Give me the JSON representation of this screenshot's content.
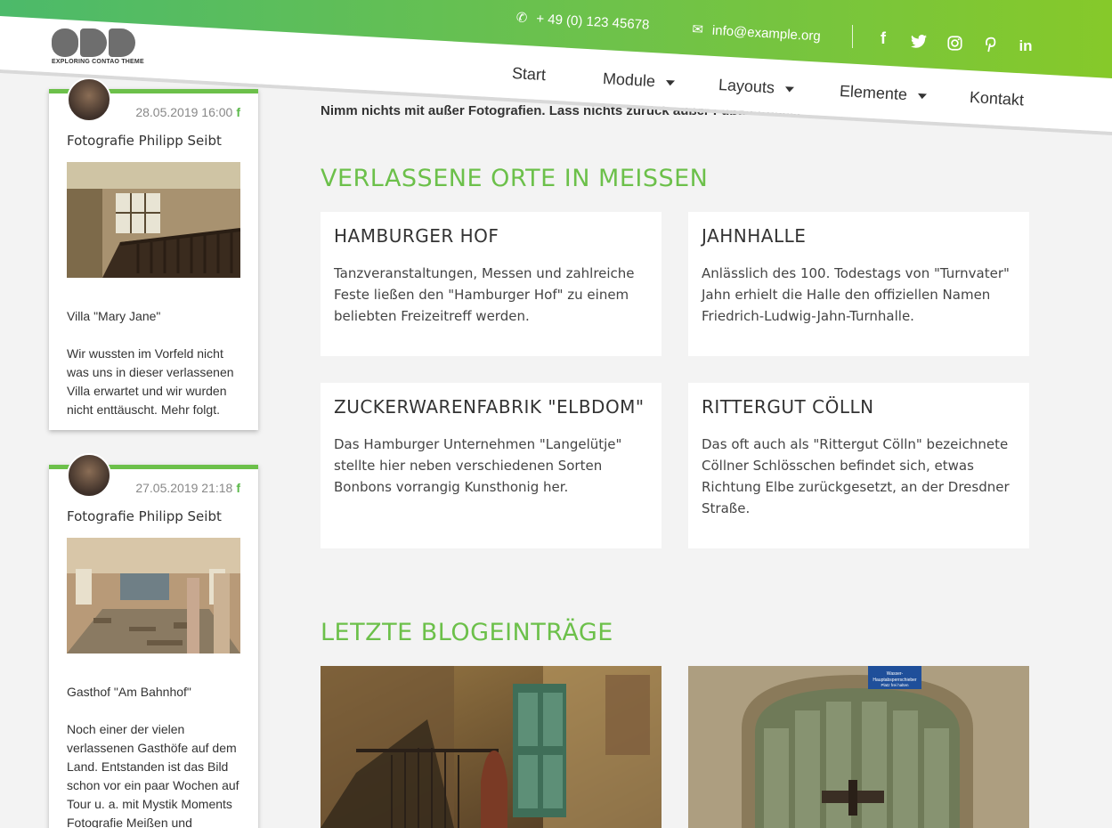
{
  "topbar": {
    "phone": "+ 49 (0) 123 45678",
    "email": "info@example.org",
    "social_icons": [
      "facebook-icon",
      "twitter-icon",
      "instagram-icon",
      "pinterest-icon",
      "linkedin-icon"
    ]
  },
  "logo": {
    "mark": "ODD",
    "tagline": "EXPLORING CONTAO THEME"
  },
  "nav": [
    {
      "label": "Start",
      "dropdown": false
    },
    {
      "label": "Module",
      "dropdown": true
    },
    {
      "label": "Layouts",
      "dropdown": true
    },
    {
      "label": "Elemente",
      "dropdown": true
    },
    {
      "label": "Kontakt",
      "dropdown": false
    }
  ],
  "sidebar": {
    "posts": [
      {
        "date": "28.05.2019 16:00",
        "author": "Fotografie Philipp Seibt",
        "title": "Villa \"Mary Jane\"",
        "text": "Wir wussten im Vorfeld nicht was uns in dieser verlassenen Villa erwartet und wir wurden nicht enttäuscht. Mehr folgt."
      },
      {
        "date": "27.05.2019 21:18",
        "author": "Fotografie Philipp Seibt",
        "title": "Gasthof \"Am Bahnhof\"",
        "text": "Noch einer der vielen verlassenen Gasthöfe auf dem Land. Entstanden ist das Bild schon vor ein paar Wochen auf Tour u. a. mit Mystik Moments Fotografie Meißen und"
      }
    ]
  },
  "main": {
    "intro": "Nimm nichts mit außer Fotografien. Lass nichts zurück außer Fußabdrücke.",
    "places_title": "VERLASSENE ORTE IN MEISSEN",
    "places": [
      {
        "title": "HAMBURGER HOF",
        "text": "Tanzveranstaltungen, Messen und zahlreiche Feste ließen den \"Hamburger Hof\" zu einem beliebten Freizeitreff werden."
      },
      {
        "title": "JAHNHALLE",
        "text": "Anlässlich des 100. Todestags von \"Turnvater\" Jahn erhielt die Halle den offiziellen Namen Friedrich-Ludwig-Jahn-Turnhalle."
      },
      {
        "title": "ZUCKERWARENFABRIK \"ELBDOM\"",
        "text": "Das Hamburger Unternehmen \"Langelütje\" stellte hier neben verschiedenen Sorten Bonbons vorrangig Kunsthonig her."
      },
      {
        "title": "RITTERGUT CÖLLN",
        "text": "Das oft auch als \"Rittergut Cölln\" bezeichnete Cöllner Schlösschen befindet sich, etwas Richtung Elbe zurückgesetzt, an der Dresdner Straße."
      }
    ],
    "blog_title": "LETZTE BLOGEINTRÄGE",
    "blog_sign": "Wasser-Hauptabsperrschieber Platz frei halten"
  },
  "colors": {
    "accent": "#6cc04a",
    "gradient_start": "#4cba6a",
    "gradient_end": "#86c92a"
  }
}
